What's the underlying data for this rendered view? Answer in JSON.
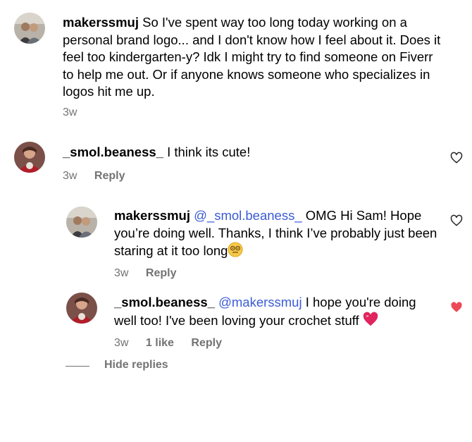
{
  "post": {
    "username": "makerssmuj",
    "caption": "So I've spent way too long today working on a personal brand logo... and I don't know how I feel about it. Does it feel too kindergarten-y? Idk I might try to find someone on Fiverr to help me out. Or if anyone knows someone who specializes in logos hit me up.",
    "time": "3w",
    "avatar_icon": "profile-photo-couple"
  },
  "comment1": {
    "username": "_smol.beaness_",
    "text": "I think its cute!",
    "time": "3w",
    "reply_label": "Reply",
    "like_icon": "heart-outline-icon"
  },
  "reply1": {
    "username": "makerssmuj",
    "mention": "@_smol.beaness_",
    "text_before_emoji": "OMG Hi Sam! Hope you’re doing well. Thanks, I think I’ve probably just been staring at it too long",
    "emoji": "dizzy-face-emoji",
    "time": "3w",
    "reply_label": "Reply",
    "like_icon": "heart-outline-icon"
  },
  "reply2": {
    "username": "_smol.beaness_",
    "mention": "@makerssmuj",
    "text_before_emoji": "I hope you're doing well too! I've been loving your crochet stuff",
    "emoji": "red-heart-emoji",
    "time": "3w",
    "likes": "1 like",
    "reply_label": "Reply",
    "like_icon": "heart-filled-icon",
    "like_color": "#ed4956"
  },
  "hide_replies_label": "Hide replies",
  "colors": {
    "secondary_text": "#737373",
    "mention": "#3b5bd6",
    "liked": "#ed4956"
  }
}
